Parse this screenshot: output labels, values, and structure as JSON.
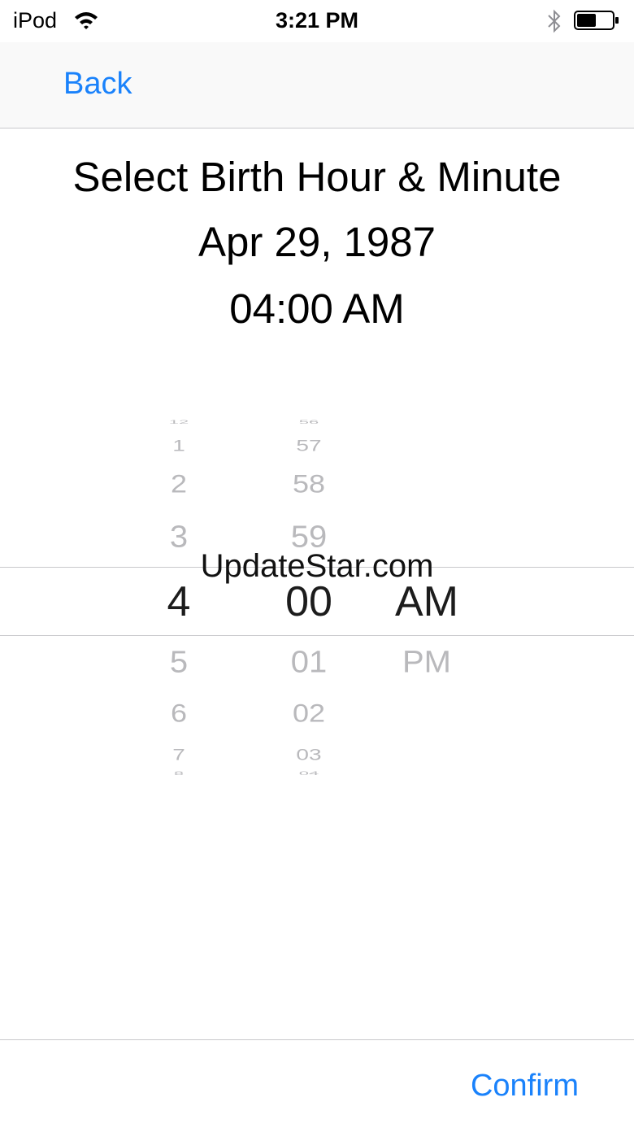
{
  "status_bar": {
    "carrier": "iPod",
    "time": "3:21 PM",
    "icons": [
      "wifi-icon",
      "bluetooth-icon",
      "battery-icon"
    ],
    "battery_level": 0.55
  },
  "nav": {
    "back_label": "Back"
  },
  "header": {
    "title": "Select Birth Hour & Minute",
    "date": "Apr 29, 1987",
    "time": "04:00 AM"
  },
  "picker": {
    "hours": [
      "12",
      "1",
      "2",
      "3",
      "4",
      "5",
      "6",
      "7",
      "8"
    ],
    "minutes": [
      "56",
      "57",
      "58",
      "59",
      "00",
      "01",
      "02",
      "03",
      "04"
    ],
    "ampm": [
      "AM",
      "PM"
    ],
    "selected": {
      "hour": "4",
      "minute": "00",
      "period": "AM"
    }
  },
  "watermark": "UpdateStar.com",
  "footer": {
    "confirm_label": "Confirm"
  },
  "colors": {
    "accent": "#1a82fb",
    "separator": "#c8c8cc",
    "picker_faded": "#b9b9bc"
  }
}
